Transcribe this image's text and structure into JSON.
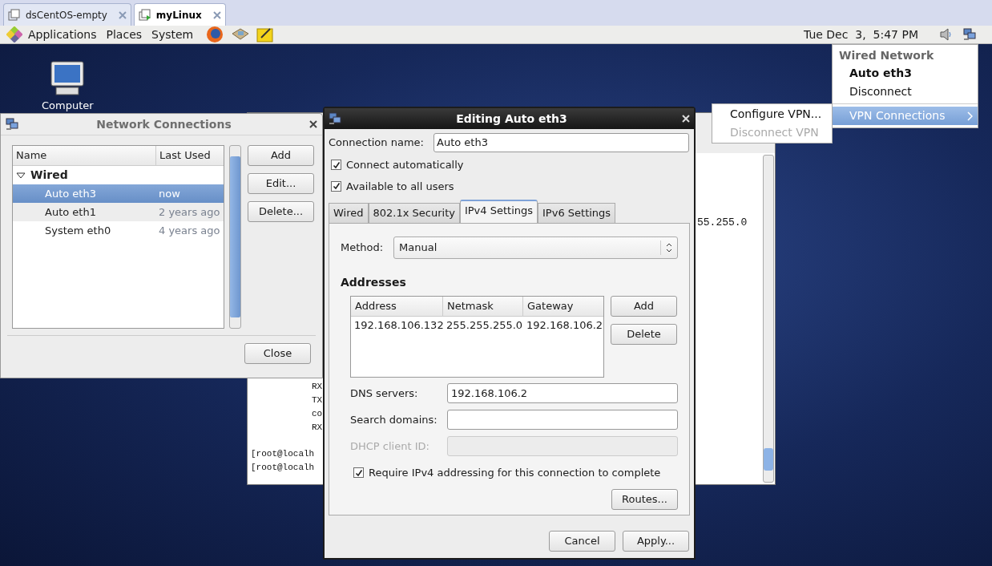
{
  "vm_tabs": [
    {
      "label": "dsCentOS-empty",
      "selected": false
    },
    {
      "label": "myLinux",
      "selected": true
    }
  ],
  "panel": {
    "menus": [
      "Applications",
      "Places",
      "System"
    ],
    "clock": "Tue Dec  3,  5:47 PM"
  },
  "desktop_icons": [
    {
      "label": "Computer"
    }
  ],
  "terminal": {
    "left_lines": [
      "RX",
      "TX",
      "co",
      "RX"
    ],
    "prompts": [
      "[root@localh",
      "[root@localh"
    ],
    "right_fragment": "55.255.0"
  },
  "network_connections": {
    "title": "Network Connections",
    "columns": [
      "Name",
      "Last Used"
    ],
    "groups": [
      {
        "label": "Wired",
        "expanded": true,
        "children": [
          {
            "name": "Auto eth3",
            "last_used": "now",
            "selected": true
          },
          {
            "name": "Auto eth1",
            "last_used": "2 years ago",
            "selected": false
          },
          {
            "name": "System eth0",
            "last_used": "4 years ago",
            "selected": false
          }
        ]
      }
    ],
    "buttons": [
      "Add",
      "Edit...",
      "Delete..."
    ],
    "close": "Close"
  },
  "editor": {
    "title": "Editing Auto eth3",
    "name_label": "Connection name:",
    "name_value": "Auto eth3",
    "checkboxes": [
      {
        "label": "Connect automatically",
        "checked": true
      },
      {
        "label": "Available to all users",
        "checked": true
      }
    ],
    "tabs": [
      {
        "label": "Wired",
        "selected": false
      },
      {
        "label": "802.1x Security",
        "selected": false
      },
      {
        "label": "IPv4 Settings",
        "selected": true
      },
      {
        "label": "IPv6 Settings",
        "selected": false
      }
    ],
    "method_label": "Method:",
    "method_value": "Manual",
    "addresses_heading": "Addresses",
    "columns": [
      "Address",
      "Netmask",
      "Gateway"
    ],
    "rows": [
      [
        "192.168.106.132",
        "255.255.255.0",
        "192.168.106.2"
      ]
    ],
    "address_buttons": [
      "Add",
      "Delete"
    ],
    "fields": [
      {
        "label": "DNS servers:",
        "value": "192.168.106.2",
        "disabled": false
      },
      {
        "label": "Search domains:",
        "disabled": false
      },
      {
        "label": "DHCP client ID:",
        "disabled": true
      }
    ],
    "require": {
      "label": "Require IPv4 addressing for this connection to complete",
      "checked": true
    },
    "routes": "Routes...",
    "footer_buttons": [
      "Cancel",
      "Apply..."
    ]
  },
  "tray_menu": {
    "header": "Wired Network",
    "items": [
      {
        "label": "Auto eth3",
        "kind": "connection",
        "selected": false
      },
      {
        "label": "Disconnect",
        "kind": "plain",
        "selected": false
      },
      {
        "label": "VPN Connections",
        "kind": "submenu",
        "selected": true
      }
    ]
  },
  "vpn_submenu": [
    {
      "label": "Configure VPN...",
      "disabled": false
    },
    {
      "label": "Disconnect VPN",
      "disabled": true
    }
  ]
}
